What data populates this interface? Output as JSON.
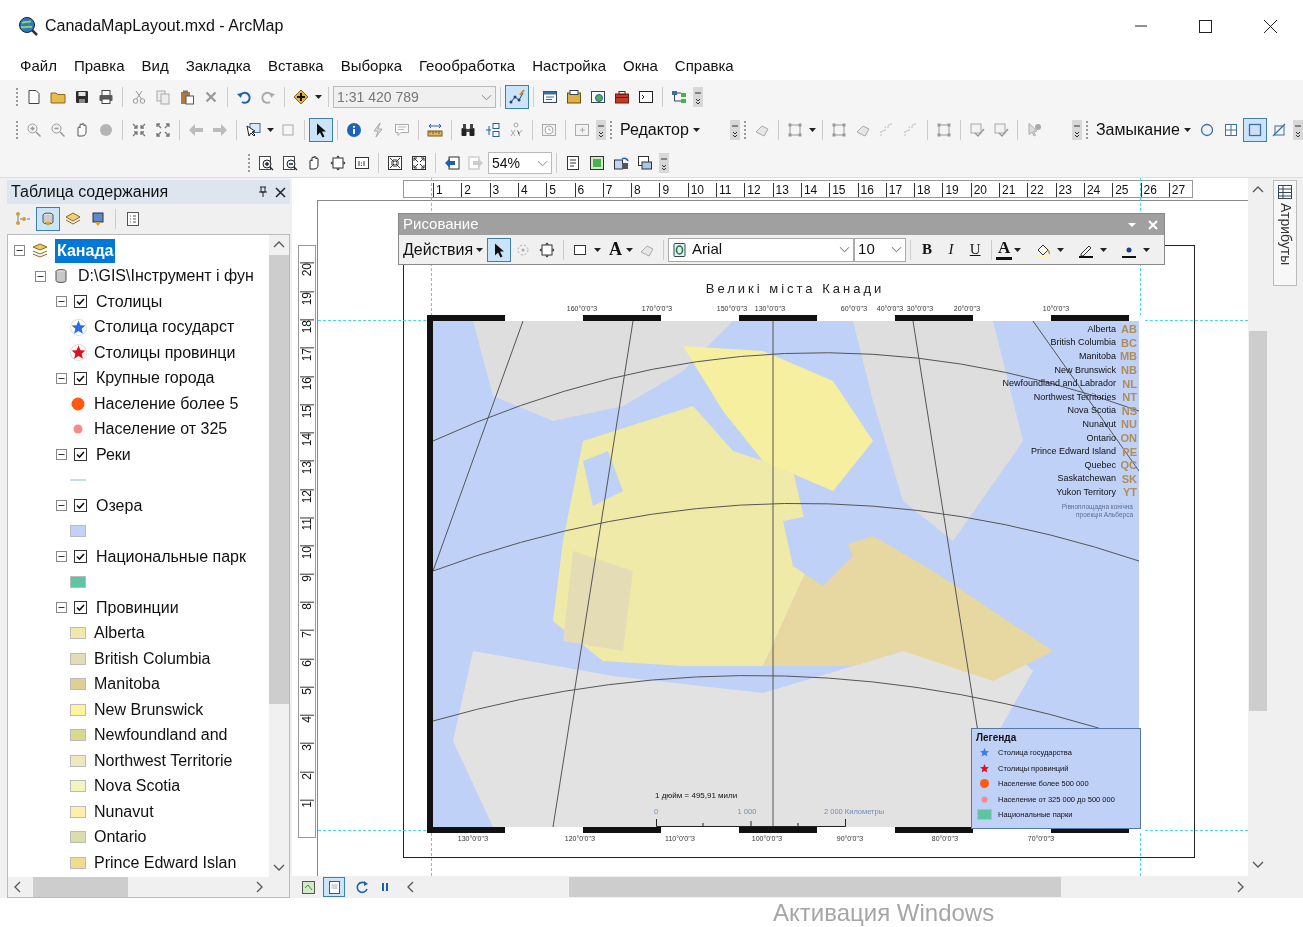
{
  "window": {
    "title": "CanadaMapLayout.mxd - ArcMap"
  },
  "menu": [
    "Файл",
    "Правка",
    "Вид",
    "Закладка",
    "Вставка",
    "Выборка",
    "Геообработка",
    "Настройка",
    "Окна",
    "Справка"
  ],
  "toolbars": {
    "scale": "1:31 420 789",
    "edit_tool_selected": true,
    "select_tool_selected": true,
    "editor": "Редактор",
    "snapping": "Замыкание",
    "snap_modes": [
      {
        "selected": false
      },
      {
        "selected": false
      },
      {
        "selected": true
      },
      {
        "selected": false
      }
    ],
    "zoom": "54%"
  },
  "toc": {
    "title": "Таблица содержания",
    "tabs": [
      {
        "selected": false
      },
      {
        "selected": true
      },
      {
        "selected": false
      },
      {
        "selected": false
      },
      {
        "selected": false
      }
    ],
    "tree": [
      {
        "kind": "map",
        "label": "Канада",
        "selected": true,
        "expanded": true,
        "children": [
          {
            "kind": "source",
            "label": "D:\\GIS\\Інструмент і фун",
            "selected": false,
            "expanded": true,
            "children": [
              {
                "kind": "layer",
                "label": "Столицы",
                "selected": false,
                "checked": true,
                "expanded": true,
                "children": [
                  {
                    "kind": "star",
                    "color": "#2a6cf0",
                    "label": "Столица государст"
                  },
                  {
                    "kind": "star",
                    "color": "#e01020",
                    "label": "Столицы провинци"
                  }
                ]
              },
              {
                "kind": "layer",
                "label": "Крупные города",
                "selected": false,
                "checked": true,
                "expanded": true,
                "children": [
                  {
                    "kind": "dot",
                    "color": "#ff5a10",
                    "label": "Население более 5"
                  },
                  {
                    "kind": "small-dot",
                    "color": "#f88a8a",
                    "label": "Население от 325"
                  }
                ]
              },
              {
                "kind": "layer",
                "label": "Реки",
                "selected": false,
                "checked": true,
                "expanded": true,
                "children": [
                  {
                    "kind": "line",
                    "color": "#c8d8f8"
                  }
                ]
              },
              {
                "kind": "layer",
                "label": "Озера",
                "selected": false,
                "checked": true,
                "expanded": true,
                "children": [
                  {
                    "kind": "patch",
                    "color": "#c2d2fa"
                  }
                ]
              },
              {
                "kind": "layer",
                "label": "Национальные парк",
                "selected": false,
                "checked": true,
                "expanded": true,
                "children": [
                  {
                    "kind": "patch",
                    "color": "#5fc4a0"
                  }
                ]
              },
              {
                "kind": "layer",
                "label": "Провинции",
                "selected": false,
                "checked": true,
                "expanded": true,
                "children": [
                  {
                    "kind": "patch",
                    "color": "#f0eaa8",
                    "label": "Alberta"
                  },
                  {
                    "kind": "patch",
                    "color": "#e4dcb4",
                    "label": "British Columbia"
                  },
                  {
                    "kind": "patch",
                    "color": "#dcd098",
                    "label": "Manitoba"
                  },
                  {
                    "kind": "patch",
                    "color": "#fbf59c",
                    "label": "New Brunswick"
                  },
                  {
                    "kind": "patch",
                    "color": "#d8d890",
                    "label": "Newfoundland and"
                  },
                  {
                    "kind": "patch",
                    "color": "#ece8c0",
                    "label": "Northwest Territorie"
                  },
                  {
                    "kind": "patch",
                    "color": "#f4f4c0",
                    "label": "Nova Scotia"
                  },
                  {
                    "kind": "patch",
                    "color": "#fbf2a8",
                    "label": "Nunavut"
                  },
                  {
                    "kind": "patch",
                    "color": "#dcdcac",
                    "label": "Ontario"
                  },
                  {
                    "kind": "patch",
                    "color": "#efdc90",
                    "label": "Prince Edward Islan"
                  }
                ]
              }
            ]
          }
        ]
      }
    ]
  },
  "ruler_h": [
    "1",
    "2",
    "3",
    "4",
    "5",
    "6",
    "7",
    "8",
    "9",
    "10",
    "11",
    "12",
    "13",
    "14",
    "15",
    "16",
    "17",
    "18",
    "19",
    "20",
    "21",
    "22",
    "23",
    "24",
    "25",
    "26",
    "27"
  ],
  "ruler_v": [
    "1",
    "2",
    "3",
    "4",
    "5",
    "6",
    "7",
    "8",
    "9",
    "10",
    "11",
    "12",
    "13",
    "14",
    "15",
    "16",
    "17",
    "18",
    "19",
    "20"
  ],
  "drawing_toolbar": {
    "title": "Рисование",
    "actions": "Действия",
    "select_selected": true,
    "text_tool": "A",
    "font": "Arial",
    "size": "10",
    "style_buttons": [
      "B",
      "I",
      "U"
    ],
    "font_color": "A"
  },
  "layout": {
    "title": "Великі міста Канади",
    "graticule_top": [
      "160°0'0\"З",
      "170°0'0\"З",
      "150°0'0\"З",
      "130°0'0\"З",
      "60°0'0\"З",
      "40°0'0\"З",
      "30°0'0\"З",
      "20°0'0\"З",
      "10°0'0\"З"
    ],
    "graticule_bottom": [
      "130°0'0\"З",
      "120°0'0\"З",
      "110°0'0\"З",
      "100°0'0\"З",
      "90°0'0\"З",
      "80°0'0\"З",
      "70°0'0\"З"
    ],
    "provinces": [
      {
        "name": "Alberta",
        "code": "AB"
      },
      {
        "name": "British Columbia",
        "code": "BC"
      },
      {
        "name": "Manitoba",
        "code": "MB"
      },
      {
        "name": "New Brunswick",
        "code": "NB"
      },
      {
        "name": "Newfoundland and Labrador",
        "code": "NL"
      },
      {
        "name": "Northwest Territories",
        "code": "NT"
      },
      {
        "name": "Nova Scotia",
        "code": "NS"
      },
      {
        "name": "Nunavut",
        "code": "NU"
      },
      {
        "name": "Ontario",
        "code": "ON"
      },
      {
        "name": "Prince Edward Island",
        "code": "PE"
      },
      {
        "name": "Quebec",
        "code": "QC"
      },
      {
        "name": "Saskatchewan",
        "code": "SK"
      },
      {
        "name": "Yukon Territory",
        "code": "YT"
      }
    ],
    "projection": [
      "Рівноплощадна конічна",
      "проекція Альберса"
    ],
    "legend": {
      "title": "Легенда",
      "items": [
        {
          "kind": "star",
          "color": "#3a7af0",
          "label": "Столица государства"
        },
        {
          "kind": "star",
          "color": "#e01020",
          "label": "Столицы провинций"
        },
        {
          "kind": "dot",
          "color": "#ff5a10",
          "label": "Население более 500 000"
        },
        {
          "kind": "small-dot",
          "color": "#f88a8a",
          "label": "Население от 325 000 до 500 000"
        },
        {
          "kind": "patch",
          "color": "#5fc4a0",
          "label": "Национальные парки"
        }
      ]
    },
    "scale_text": "1 дюйм = 495,91 мили",
    "scale_labels": [
      "0",
      "1 000",
      "2 000 Километры"
    ]
  },
  "side_tab": "Атрибуты",
  "bottom_views": [
    {
      "selected": false
    },
    {
      "selected": true
    }
  ],
  "watermark": "Активация Windows"
}
